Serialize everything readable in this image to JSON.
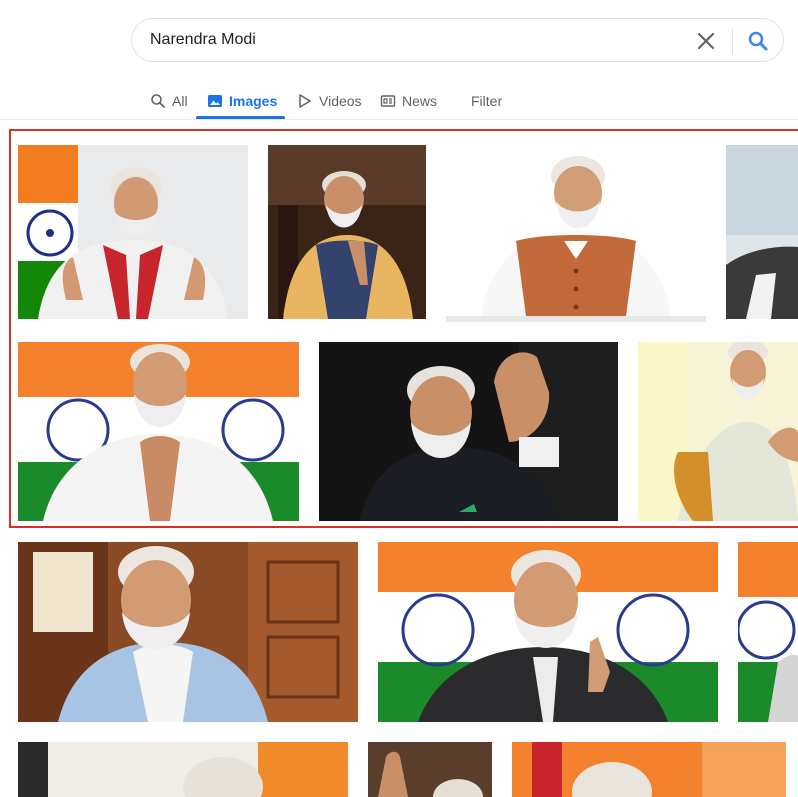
{
  "search": {
    "query": "Narendra Modi"
  },
  "tabs": [
    {
      "label": "All"
    },
    {
      "label": "Images"
    },
    {
      "label": "Videos"
    },
    {
      "label": "News"
    },
    {
      "label": "Filter"
    }
  ],
  "colors": {
    "accent": "#1a73e8",
    "highlight_border": "#d93025",
    "saffron": "#f47c20",
    "india_green": "#138808",
    "chakra_blue": "#1f2f86"
  },
  "icons": [
    "search-icon",
    "clear-icon",
    "image-icon",
    "video-play-icon",
    "news-icon"
  ]
}
